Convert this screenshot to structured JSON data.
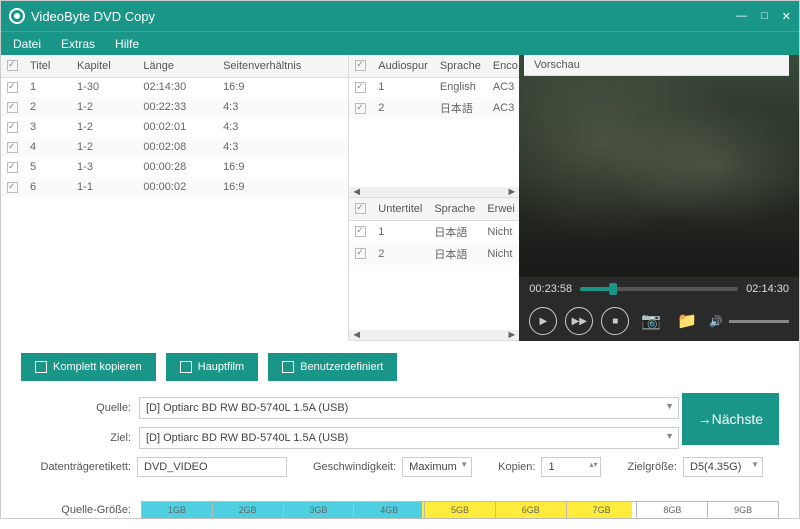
{
  "titlebar": {
    "title": "VideoByte DVD Copy"
  },
  "menu": {
    "file": "Datei",
    "extras": "Extras",
    "help": "Hilfe"
  },
  "titles": {
    "headers": {
      "chk": "",
      "title": "Titel",
      "chapter": "Kapitel",
      "length": "Länge",
      "ratio": "Seitenverhältnis"
    },
    "rows": [
      {
        "n": "1",
        "ch": "1-30",
        "len": "02:14:30",
        "ar": "16:9"
      },
      {
        "n": "2",
        "ch": "1-2",
        "len": "00:22:33",
        "ar": "4:3"
      },
      {
        "n": "3",
        "ch": "1-2",
        "len": "00:02:01",
        "ar": "4:3"
      },
      {
        "n": "4",
        "ch": "1-2",
        "len": "00:02:08",
        "ar": "4:3"
      },
      {
        "n": "5",
        "ch": "1-3",
        "len": "00:00:28",
        "ar": "16:9"
      },
      {
        "n": "6",
        "ch": "1-1",
        "len": "00:00:02",
        "ar": "16:9"
      }
    ]
  },
  "audio": {
    "headers": {
      "track": "Audiospur",
      "lang": "Sprache",
      "enc": "Enco"
    },
    "rows": [
      {
        "n": "1",
        "lang": "English",
        "enc": "AC3"
      },
      {
        "n": "2",
        "lang": "日本語",
        "enc": "AC3"
      }
    ]
  },
  "subs": {
    "headers": {
      "track": "Untertitel",
      "lang": "Sprache",
      "ext": "Erwei"
    },
    "rows": [
      {
        "n": "1",
        "lang": "日本語",
        "ext": "Nicht"
      },
      {
        "n": "2",
        "lang": "日本語",
        "ext": "Nicht"
      }
    ]
  },
  "preview": {
    "label": "Vorschau",
    "cur": "00:23:58",
    "total": "02:14:30"
  },
  "modes": {
    "full": "Komplett kopieren",
    "main": "Hauptfilm",
    "custom": "Benutzerdefiniert"
  },
  "form": {
    "source_label": "Quelle:",
    "source": "[D] Optiarc BD RW BD-5740L 1.5A (USB)",
    "target_label": "Ziel:",
    "target": "[D] Optiarc BD RW BD-5740L 1.5A (USB)",
    "disc_label_label": "Datenträgeretikett:",
    "disc_label": "DVD_VIDEO",
    "speed_label": "Geschwindigkeit:",
    "speed": "Maximum",
    "copies_label": "Kopien:",
    "copies": "1",
    "targetsize_label": "Zielgröße:",
    "targetsize": "D5(4.35G)",
    "next": "→Nächste"
  },
  "size": {
    "label": "Quelle-Größe:",
    "ticks": [
      "1GB",
      "2GB",
      "3GB",
      "4GB",
      "5GB",
      "6GB",
      "7GB",
      "8GB",
      "9GB"
    ]
  }
}
